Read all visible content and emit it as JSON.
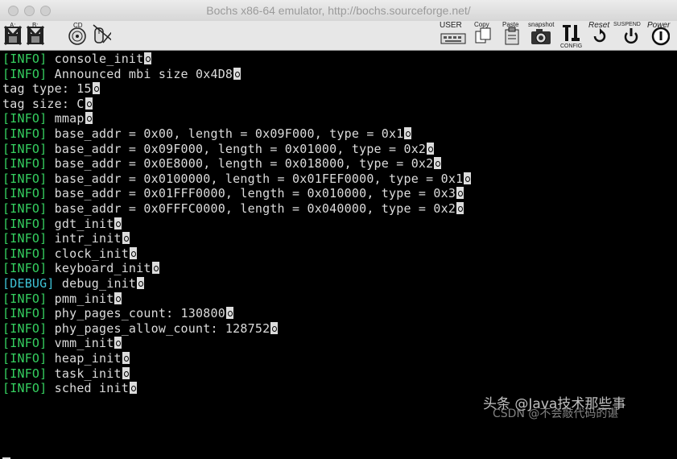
{
  "window": {
    "title": "Bochs x86-64 emulator, http://bochs.sourceforge.net/"
  },
  "toolbar": {
    "user_label": "USER",
    "copy_label": "Copy",
    "paste_label": "Paste",
    "snapshot_label": "snapshot",
    "config_label": "CONFIG",
    "reset_label": "Reset",
    "suspend_label": "SUSPEND",
    "power_label": "Power",
    "floppy_a_label": "A:",
    "floppy_b_label": "B:",
    "cd_label": "CD"
  },
  "console": {
    "lines": [
      {
        "tag": "[INFO]",
        "kind": "info",
        "text": " console_init"
      },
      {
        "tag": "[INFO]",
        "kind": "info",
        "text": " Announced mbi size 0x4D8"
      },
      {
        "tag": "",
        "kind": "plain",
        "text": "tag type: 15"
      },
      {
        "tag": "",
        "kind": "plain",
        "text": "tag size: C"
      },
      {
        "tag": "[INFO]",
        "kind": "info",
        "text": " mmap"
      },
      {
        "tag": "[INFO]",
        "kind": "info",
        "text": " base_addr = 0x00, length = 0x09F000, type = 0x1"
      },
      {
        "tag": "[INFO]",
        "kind": "info",
        "text": " base_addr = 0x09F000, length = 0x01000, type = 0x2"
      },
      {
        "tag": "[INFO]",
        "kind": "info",
        "text": " base_addr = 0x0E8000, length = 0x018000, type = 0x2"
      },
      {
        "tag": "[INFO]",
        "kind": "info",
        "text": " base_addr = 0x0100000, length = 0x01FEF0000, type = 0x1"
      },
      {
        "tag": "[INFO]",
        "kind": "info",
        "text": " base_addr = 0x01FFF0000, length = 0x010000, type = 0x3"
      },
      {
        "tag": "[INFO]",
        "kind": "info",
        "text": " base_addr = 0x0FFFC0000, length = 0x040000, type = 0x2"
      },
      {
        "tag": "[INFO]",
        "kind": "info",
        "text": " gdt_init"
      },
      {
        "tag": "[INFO]",
        "kind": "info",
        "text": " intr_init"
      },
      {
        "tag": "[INFO]",
        "kind": "info",
        "text": " clock_init"
      },
      {
        "tag": "[INFO]",
        "kind": "info",
        "text": " keyboard_init"
      },
      {
        "tag": "[DEBUG]",
        "kind": "debug",
        "text": " debug_init"
      },
      {
        "tag": "[INFO]",
        "kind": "info",
        "text": " pmm_init"
      },
      {
        "tag": "[INFO]",
        "kind": "info",
        "text": " phy_pages_count: 130800"
      },
      {
        "tag": "[INFO]",
        "kind": "info",
        "text": " phy_pages_allow_count: 128752"
      },
      {
        "tag": "[INFO]",
        "kind": "info",
        "text": " vmm_init"
      },
      {
        "tag": "[INFO]",
        "kind": "info",
        "text": " heap_init"
      },
      {
        "tag": "[INFO]",
        "kind": "info",
        "text": " task_init"
      },
      {
        "tag": "[INFO]",
        "kind": "info",
        "text": " sched init"
      }
    ]
  },
  "watermark": {
    "line1": "头条 @Java技术那些事",
    "line2": "CSDN @不会敲代码的谌"
  },
  "colors": {
    "info": "#35d060",
    "debug": "#3ec3d6",
    "text": "#dcdcdc"
  }
}
